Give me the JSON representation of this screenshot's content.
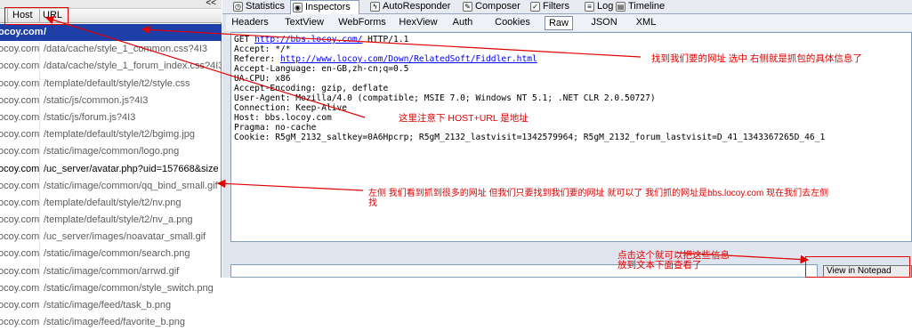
{
  "left_panel": {
    "collapse_label": "<<",
    "columns": {
      "host": "Host",
      "url": "URL"
    },
    "rows": [
      {
        "host": "ocoy.com",
        "url": "/"
      },
      {
        "host": "ocoy.com",
        "url": "/data/cache/style_1_common.css?4I3"
      },
      {
        "host": "ocoy.com",
        "url": "/data/cache/style_1_forum_index.css?4I3"
      },
      {
        "host": "ocoy.com",
        "url": "/template/default/style/t2/style.css"
      },
      {
        "host": "ocoy.com",
        "url": "/static/js/common.js?4I3"
      },
      {
        "host": "ocoy.com",
        "url": "/static/js/forum.js?4I3"
      },
      {
        "host": "ocoy.com",
        "url": "/template/default/style/t2/bgimg.jpg"
      },
      {
        "host": "ocoy.com",
        "url": "/static/image/common/logo.png"
      },
      {
        "host": "ocoy.com",
        "url": "/uc_server/avatar.php?uid=157668&size"
      },
      {
        "host": "ocoy.com",
        "url": "/static/image/common/qq_bind_small.gif"
      },
      {
        "host": "ocoy.com",
        "url": "/template/default/style/t2/nv.png"
      },
      {
        "host": "ocoy.com",
        "url": "/template/default/style/t2/nv_a.png"
      },
      {
        "host": "ocoy.com",
        "url": "/uc_server/images/noavatar_small.gif"
      },
      {
        "host": "ocoy.com",
        "url": "/static/image/common/search.png"
      },
      {
        "host": "ocoy.com",
        "url": "/static/image/common/arrwd.gif"
      },
      {
        "host": "ocoy.com",
        "url": "/static/image/common/style_switch.png"
      },
      {
        "host": "ocoy.com",
        "url": "/static/image/feed/task_b.png"
      },
      {
        "host": "ocoy.com",
        "url": "/static/image/feed/favorite_b.png"
      }
    ]
  },
  "top_tabs": [
    {
      "label": "Statistics",
      "icon": "clock-icon"
    },
    {
      "label": "Inspectors",
      "icon": "inspector-icon"
    },
    {
      "label": "AutoResponder",
      "icon": "lightning-icon"
    },
    {
      "label": "Composer",
      "icon": "composer-icon"
    },
    {
      "label": "Filters",
      "icon": "checkbox-icon"
    },
    {
      "label": "Log",
      "icon": "log-icon"
    },
    {
      "label": "Timeline",
      "icon": "timeline-icon"
    }
  ],
  "sub_tabs": [
    "Headers",
    "TextView",
    "WebForms",
    "HexView",
    "Auth",
    "Cookies",
    "Raw",
    "JSON",
    "XML"
  ],
  "raw_request": {
    "l1_pre": "GET ",
    "l1_link": "http://bbs.locoy.com/",
    "l1_post": " HTTP/1.1",
    "l2": "Accept: */*",
    "l3_pre": "Referer: ",
    "l3_link": "http://www.locoy.com/Down/RelatedSoft/Fiddler.html",
    "l4": "Accept-Language: en-GB,zh-cn;q=0.5",
    "l5": "UA-CPU: x86",
    "l6": "Accept-Encoding: gzip, deflate",
    "l7": "User-Agent: Mozilla/4.0 (compatible; MSIE 7.0; Windows NT 5.1; .NET CLR 2.0.50727)",
    "l8": "Connection: Keep-Alive",
    "l9": "Host: bbs.locoy.com",
    "l10": "Pragma: no-cache",
    "l11": "Cookie: R5gM_2132_saltkey=0A6Hpcrp; R5gM_2132_lastvisit=1342579964; R5gM_2132_forum_lastvisit=D_41_1343367265D_46_1"
  },
  "notepad_button": "View in Notepad",
  "annotations": {
    "a1": "找到我们要的网址 选中 右侧就是抓包的具体信息了",
    "a2": "这里注意下 HOST+URL 是地址",
    "a3_line1": "左侧 我们看到抓到很多的网址 但我们只要找到我们要的网址 就可以了 我们抓的网址是bbs.locoy.com 现在我们去左侧",
    "a3_line2": "找",
    "a4_line1": "点击这个就可以把这些信息",
    "a4_line2": "放到文本下面查看了"
  },
  "colors": {
    "annotation": "#e00000",
    "selection": "#1e3fa8"
  }
}
